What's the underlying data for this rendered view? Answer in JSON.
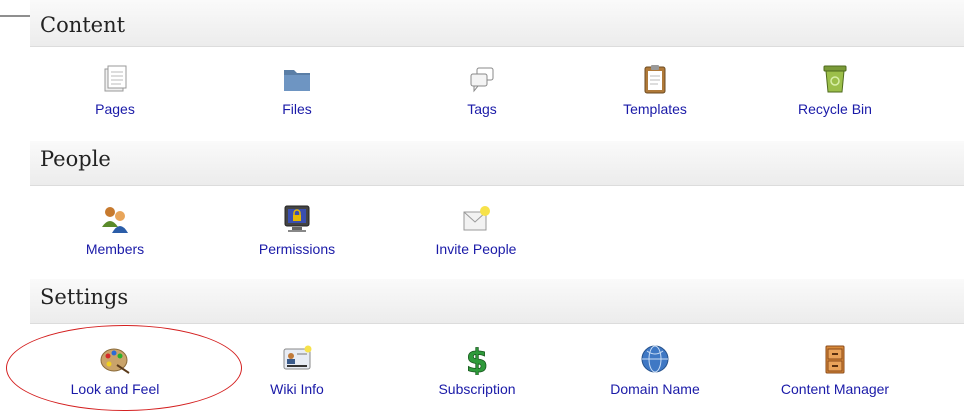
{
  "sections": {
    "content": {
      "title": "Content",
      "items": [
        {
          "label": "Pages",
          "icon": "pages-icon"
        },
        {
          "label": "Files",
          "icon": "folder-icon"
        },
        {
          "label": "Tags",
          "icon": "tags-icon"
        },
        {
          "label": "Templates",
          "icon": "clipboard-icon"
        },
        {
          "label": "Recycle Bin",
          "icon": "recycle-bin-icon"
        }
      ]
    },
    "people": {
      "title": "People",
      "items": [
        {
          "label": "Members",
          "icon": "members-icon"
        },
        {
          "label": "Permissions",
          "icon": "lock-screen-icon"
        },
        {
          "label": "Invite People",
          "icon": "envelope-icon"
        }
      ]
    },
    "settings": {
      "title": "Settings",
      "items": [
        {
          "label": "Look and Feel",
          "icon": "palette-icon"
        },
        {
          "label": "Wiki Info",
          "icon": "id-card-icon"
        },
        {
          "label": "Subscription",
          "icon": "dollar-icon"
        },
        {
          "label": "Domain Name",
          "icon": "globe-icon"
        },
        {
          "label": "Content Manager",
          "icon": "cabinet-icon"
        }
      ]
    }
  },
  "colors": {
    "link": "#1a1aa8",
    "annotation": "#d42020"
  }
}
